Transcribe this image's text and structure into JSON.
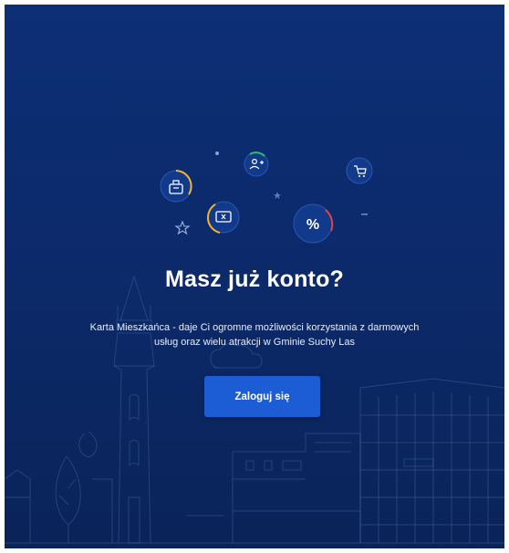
{
  "login_prompt": {
    "heading": "Masz już konto?",
    "description": "Karta Mieszkańca - daje Ci ogromne możliwości korzystania z darmowych usług oraz wielu atrakcji w Gminie Suchy Las",
    "login_button": "Zaloguj się"
  },
  "icons": [
    "id-card-icon",
    "add-user-icon",
    "cart-icon",
    "ticket-icon",
    "percent-icon",
    "star-icon",
    "dot-icon",
    "dash-icon"
  ],
  "colors": {
    "background": "#0c2a6b",
    "button": "#1c5dd6",
    "accent_yellow": "#f2b431",
    "accent_green": "#2fbf71",
    "accent_red": "#e04545"
  }
}
